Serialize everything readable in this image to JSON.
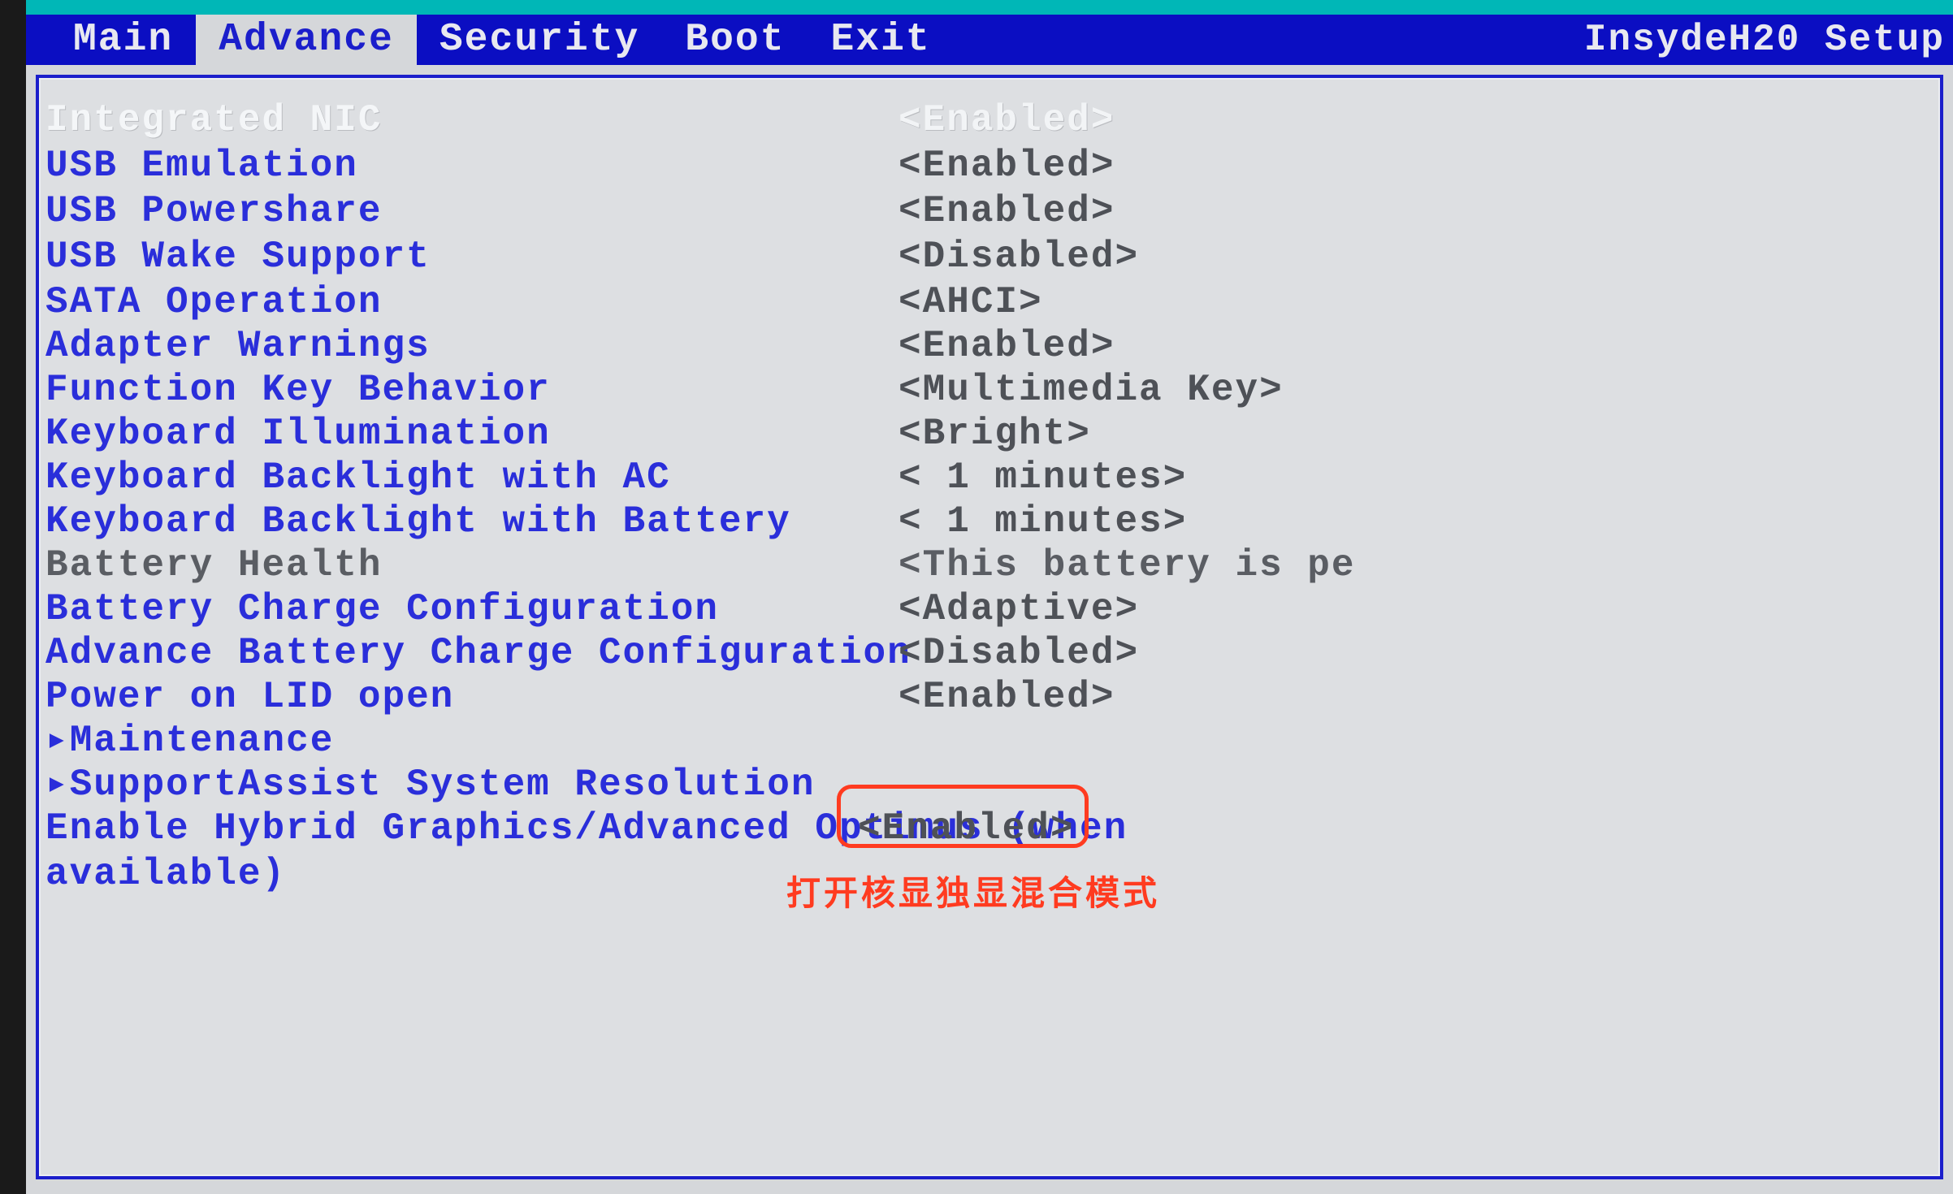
{
  "header": {
    "title_right": "InsydeH20 Setup ",
    "tabs": [
      "Main",
      "Advance",
      "Security",
      "Boot",
      "Exit"
    ]
  },
  "settings": [
    {
      "label": "Integrated NIC",
      "value": "<Enabled>",
      "selected": true
    },
    {
      "label": "USB Emulation",
      "value": "<Enabled>"
    },
    {
      "label": "USB Powershare",
      "value": "<Enabled>"
    },
    {
      "label": "USB Wake Support",
      "value": "<Disabled>"
    },
    {
      "label": "SATA Operation",
      "value": "<AHCI>"
    },
    {
      "label": "Adapter Warnings",
      "value": "<Enabled>"
    },
    {
      "label": "Function Key Behavior",
      "value": "<Multimedia Key>"
    },
    {
      "label": "Keyboard Illumination",
      "value": "<Bright>"
    },
    {
      "label": "Keyboard Backlight with AC",
      "value": "< 1 minutes>"
    },
    {
      "label": "Keyboard Backlight with Battery",
      "value": "< 1 minutes>"
    },
    {
      "label": "Battery Health",
      "value": "<This battery is pe",
      "dim": true
    },
    {
      "label": "Battery Charge Configuration",
      "value": "<Adaptive>"
    },
    {
      "label": "Advance Battery Charge Configuration",
      "value": "<Disabled>"
    },
    {
      "label": "Power on LID open",
      "value": "<Enabled>"
    },
    {
      "label": "▸Maintenance",
      "value": ""
    },
    {
      "label": "▸SupportAssist System Resolution",
      "value": ""
    },
    {
      "label": "Enable Hybrid Graphics/Advanced Optimus (when",
      "value": "<Enabled>"
    }
  ],
  "wrap_line": "available)",
  "annotation": "打开核显独显混合模式"
}
